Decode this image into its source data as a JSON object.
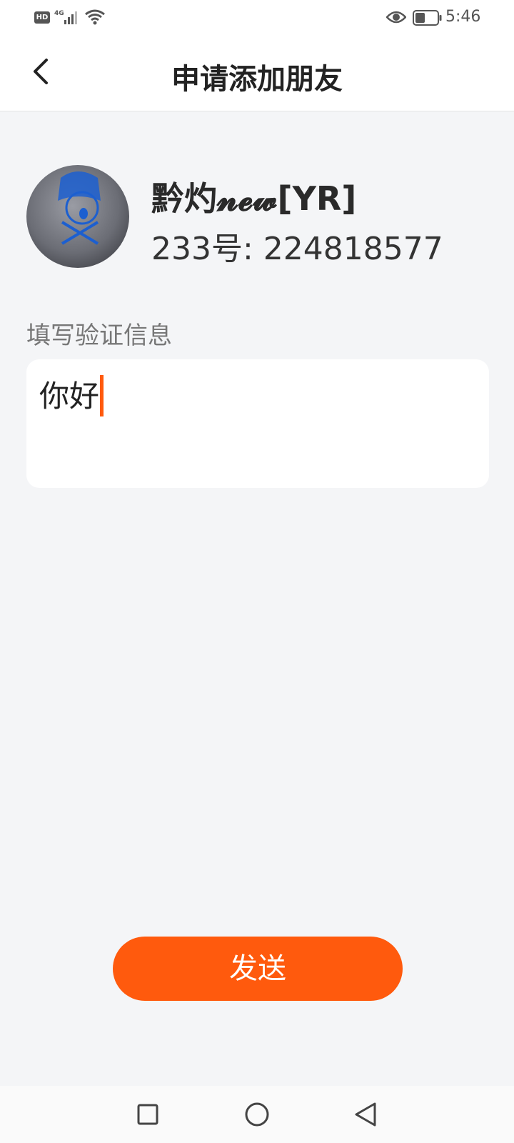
{
  "status_bar": {
    "hd": "HD",
    "network": "4G",
    "time": "5:46"
  },
  "header": {
    "title": "申请添加朋友",
    "back_icon": "chevron-left-icon"
  },
  "profile": {
    "nickname": "黔灼𝓷𝓮𝔀[YR]",
    "uid": "233号: 224818577"
  },
  "verify": {
    "label": "填写验证信息",
    "value": "你好"
  },
  "send_button": {
    "label": "发送"
  },
  "nav_bar": {
    "icons": [
      "square-icon",
      "circle-icon",
      "triangle-back-icon"
    ]
  },
  "colors": {
    "accent": "#ff5a0d",
    "background": "#f4f5f7"
  }
}
